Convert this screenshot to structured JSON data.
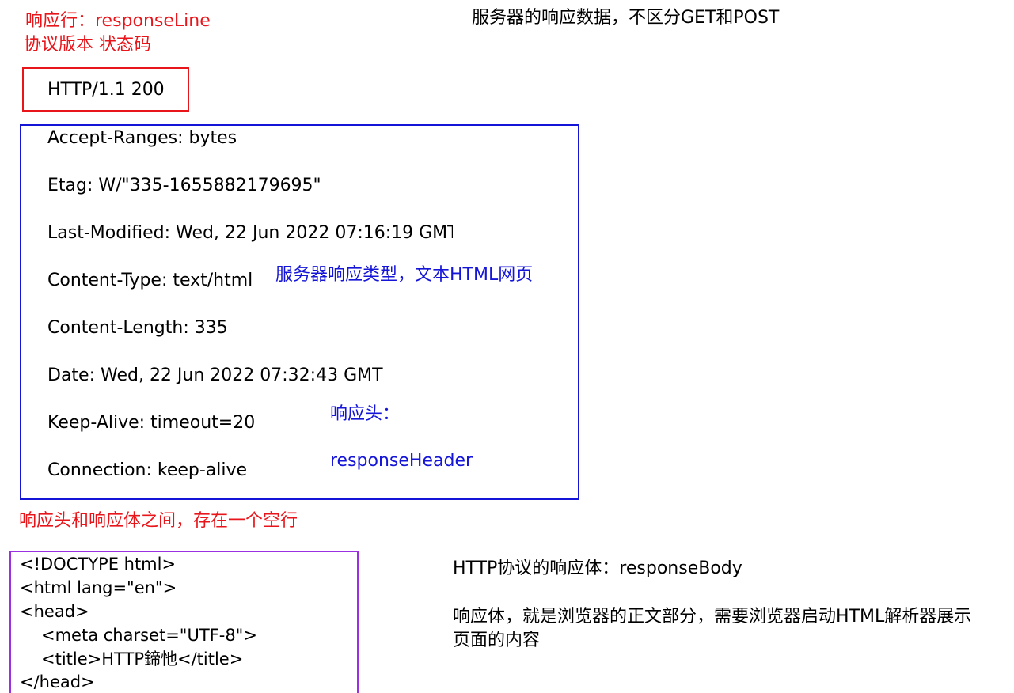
{
  "response_line_note": {
    "title": "响应行：responseLine",
    "subtitle": "协议版本  状态码"
  },
  "status_line": "HTTP/1.1 200",
  "top_caption": "服务器的响应数据，不区分GET和POST",
  "headers": [
    "Accept-Ranges: bytes",
    "Etag: W/\"335-1655882179695\"",
    "Last-Modified: Wed, 22 Jun 2022 07:16:19 GMT",
    "Content-Type: text/html",
    "Content-Length: 335",
    "Date: Wed, 22 Jun 2022 07:32:43 GMT",
    "Keep-Alive: timeout=20",
    "Connection: keep-alive"
  ],
  "content_type_note": "服务器响应类型，文本HTML网页",
  "header_note": {
    "title": "响应头：",
    "name": "responseHeader"
  },
  "blank_line_note": "响应头和响应体之间，存在一个空行",
  "body_code": [
    "<!DOCTYPE html>",
    "<html lang=\"en\">",
    "<head>",
    "<meta charset=\"UTF-8\">",
    "<title>HTTP鍗忚</title>",
    "</head>"
  ],
  "body_note": {
    "title": "HTTP协议的响应体：responseBody",
    "desc_line1": "响应体，就是浏览器的正文部分，需要浏览器启动HTML解析器展示",
    "desc_line2": "页面的内容"
  },
  "colors": {
    "red": "#e8161b",
    "blue": "#1515d8",
    "purple": "#9b30e0"
  }
}
